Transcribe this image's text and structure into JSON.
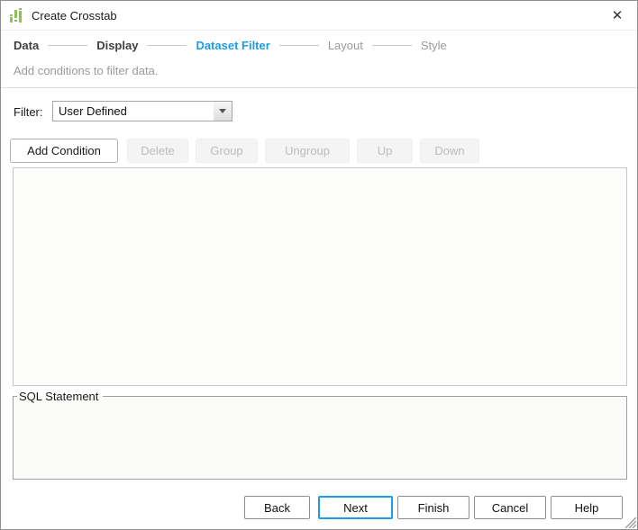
{
  "window": {
    "title": "Create Crosstab",
    "close_glyph": "✕"
  },
  "wizard": {
    "steps": [
      {
        "label": "Data",
        "state": "done"
      },
      {
        "label": "Display",
        "state": "done"
      },
      {
        "label": "Dataset Filter",
        "state": "active"
      },
      {
        "label": "Layout",
        "state": "upcoming"
      },
      {
        "label": "Style",
        "state": "upcoming"
      }
    ]
  },
  "subtitle": "Add conditions to filter data.",
  "filter": {
    "label": "Filter:",
    "value": "User Defined"
  },
  "toolbar": {
    "add_condition": "Add Condition",
    "delete": "Delete",
    "group": "Group",
    "ungroup": "Ungroup",
    "up": "Up",
    "down": "Down"
  },
  "sql": {
    "legend": "SQL Statement",
    "content": ""
  },
  "footer": {
    "back": "Back",
    "next": "Next",
    "finish": "Finish",
    "cancel": "Cancel",
    "help": "Help"
  },
  "colors": {
    "accent_blue": "#1d9ce5",
    "icon_green": "#8dc153",
    "disabled_text": "#bcbcbc"
  }
}
